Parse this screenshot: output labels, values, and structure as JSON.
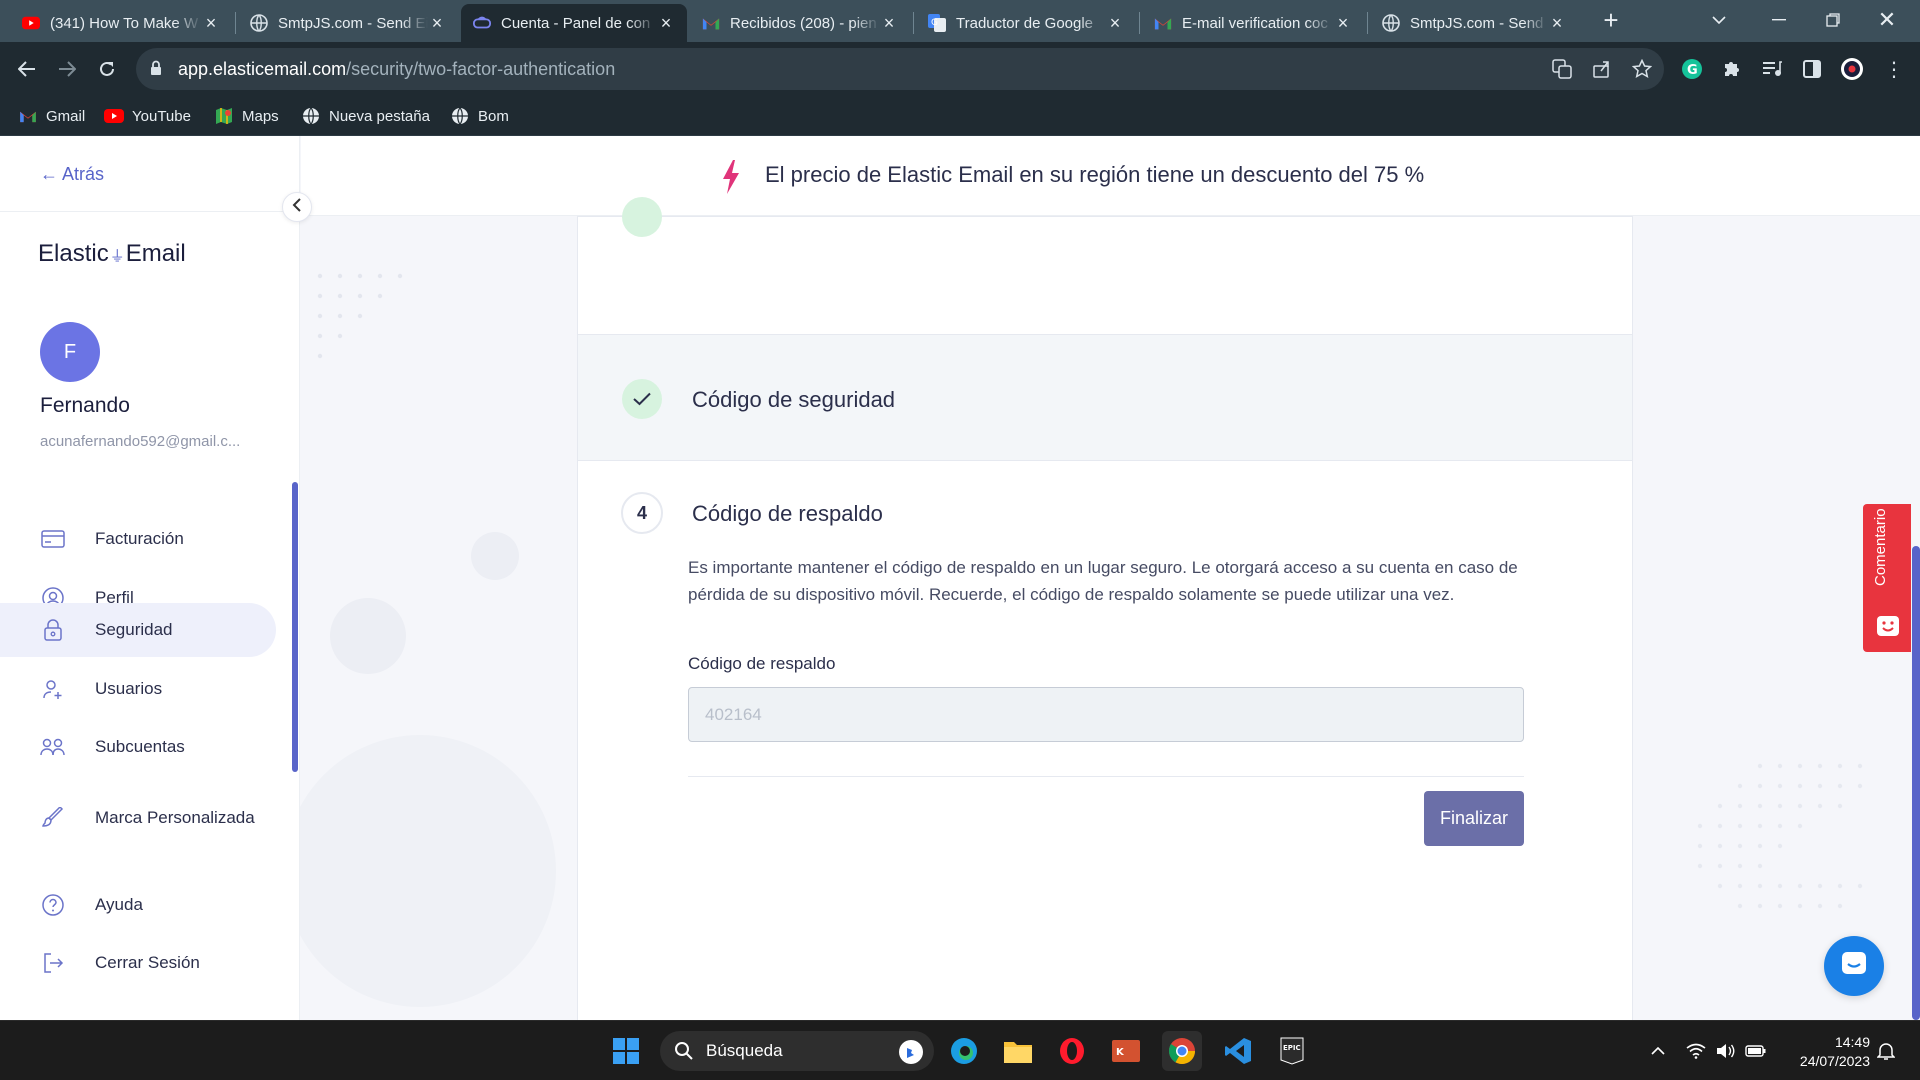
{
  "browser": {
    "tabs": [
      {
        "title": "(341) How To Make W",
        "icon": "youtube-icon",
        "active": false
      },
      {
        "title": "SmtpJS.com - Send Ei",
        "icon": "globe-icon",
        "active": false
      },
      {
        "title": "Cuenta - Panel de con",
        "icon": "elastic-email-icon",
        "active": true
      },
      {
        "title": "Recibidos (208) - pien",
        "icon": "gmail-icon",
        "active": false
      },
      {
        "title": "Traductor de Google",
        "icon": "google-translate-icon",
        "active": false
      },
      {
        "title": "E-mail verification coc",
        "icon": "gmail-icon",
        "active": false
      },
      {
        "title": "SmtpJS.com - Send Er",
        "icon": "globe-icon",
        "active": false
      }
    ],
    "url_domain": "app.elasticemail.com",
    "url_path": "/security/two-factor-authentication",
    "bookmarks": [
      {
        "label": "Gmail",
        "icon": "gmail-icon"
      },
      {
        "label": "YouTube",
        "icon": "youtube-icon"
      },
      {
        "label": "Maps",
        "icon": "maps-icon"
      },
      {
        "label": "Nueva pestaña",
        "icon": "globe-icon"
      },
      {
        "label": "Bom",
        "icon": "globe-icon"
      }
    ]
  },
  "sidebar": {
    "back_label": "← Atrás",
    "logo_left": "Elastic",
    "logo_right": "Email",
    "avatar_initial": "F",
    "user_name": "Fernando",
    "user_email": "acunafernando592@gmail.c...",
    "items": [
      {
        "label": "Facturación",
        "icon": "credit-card-icon",
        "active": false
      },
      {
        "label": "Perfil",
        "icon": "user-circle-icon",
        "active": false
      },
      {
        "label": "Seguridad",
        "icon": "lock-icon",
        "active": true
      },
      {
        "label": "Usuarios",
        "icon": "add-user-icon",
        "active": false
      },
      {
        "label": "Subcuentas",
        "icon": "users-icon",
        "active": false
      },
      {
        "label": "Marca Personalizada",
        "icon": "brush-icon",
        "active": false
      },
      {
        "label": "Ayuda",
        "icon": "help-icon",
        "active": false
      },
      {
        "label": "Cerrar Sesión",
        "icon": "logout-icon",
        "active": false
      }
    ]
  },
  "banner": {
    "text": "El precio de Elastic Email en su región tiene un descuento del 75 %",
    "icon": "lightning-icon"
  },
  "steps": {
    "step3": {
      "title": "Código de seguridad",
      "status": "completed"
    },
    "step4": {
      "number": "4",
      "title": "Código de respaldo",
      "description": "Es importante mantener el código de respaldo en un lugar seguro. Le otorgará acceso a su cuenta en caso de pérdida de su dispositivo móvil. Recuerde, el código de respaldo solamente se puede utilizar una vez.",
      "field_label": "Código de respaldo",
      "field_value": "402164",
      "finish_label": "Finalizar"
    }
  },
  "widgets": {
    "feedback_label": "Comentario"
  },
  "taskbar": {
    "search_label": "Búsqueda",
    "time": "14:49",
    "date": "24/07/2023"
  },
  "colors": {
    "accent": "#5864c9",
    "finish_button": "#6b6fa8",
    "feedback": "#e8343e",
    "chat": "#1a80e6",
    "banner_icon": "#e0347a",
    "success": "#d7f3df"
  }
}
